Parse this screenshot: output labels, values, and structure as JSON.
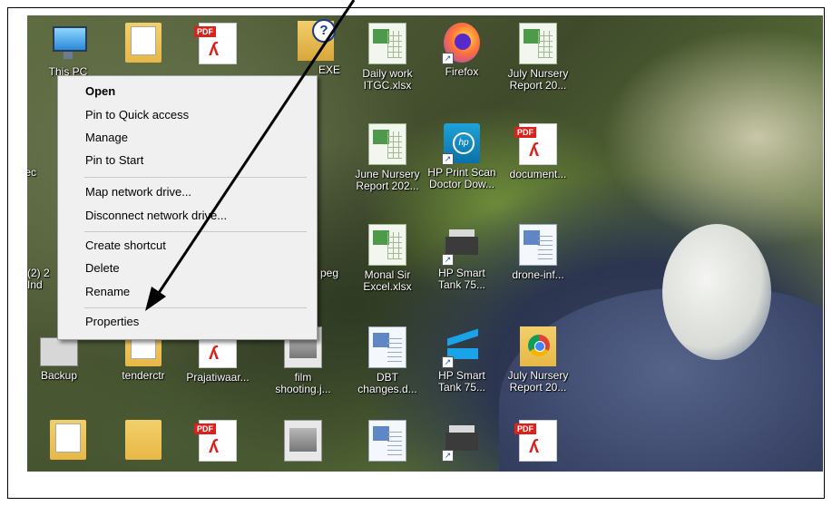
{
  "desktop": {
    "row1": [
      {
        "label": "This PC",
        "icon": "this-pc-icon"
      },
      {
        "label": "",
        "icon": "pdf-folder-icon"
      },
      {
        "label": "",
        "icon": "pdf-icon",
        "pdf_tag": "PDF"
      },
      {
        "label": "EXE",
        "icon": "help-folder-icon"
      },
      {
        "label": "Daily work\nITGC.xlsx",
        "icon": "excel-file-icon"
      },
      {
        "label": "Firefox",
        "icon": "firefox-icon"
      },
      {
        "label": "July Nursery\nReport 20...",
        "icon": "excel-file-icon"
      }
    ],
    "row2": [
      {
        "label": "Rec",
        "icon": "recycle-bin-icon"
      },
      {
        "label": "June Nursery\nReport 202...",
        "icon": "excel-file-icon"
      },
      {
        "label": "HP Print Scan\nDoctor Dow...",
        "icon": "hp-print-scan-doctor-icon"
      },
      {
        "label": "document...",
        "icon": "pdf-icon",
        "pdf_tag": "PDF"
      }
    ],
    "row3": [
      {
        "label": "(2) 2\nInd",
        "icon": "file-icon"
      },
      {
        "label": "peg",
        "icon": "image-file-icon"
      },
      {
        "label": "Monal Sir\nExcel.xlsx",
        "icon": "excel-file-icon"
      },
      {
        "label": "HP Smart\nTank 75...",
        "icon": "printer-icon"
      },
      {
        "label": "drone-inf...",
        "icon": "word-file-icon"
      }
    ],
    "row4": [
      {
        "label": "Backup",
        "icon": "drive-icon"
      },
      {
        "label": "tenderctr",
        "icon": "folder-icon"
      },
      {
        "label": "Prajatiwaar...",
        "icon": "pdf-icon"
      },
      {
        "label": "film\nshooting.j...",
        "icon": "image-file-icon"
      },
      {
        "label": "DBT\nchanges.d...",
        "icon": "word-file-icon"
      },
      {
        "label": "HP Smart\nTank 75...",
        "icon": "scanner-icon"
      },
      {
        "label": "July Nursery\nReport 20...",
        "icon": "chrome-folder-icon"
      }
    ],
    "row5": [
      {
        "label": "",
        "icon": "folder-icon"
      },
      {
        "label": "",
        "icon": "folder-icon"
      },
      {
        "label": "",
        "icon": "pdf-icon",
        "pdf_tag": "PDF"
      },
      {
        "label": "",
        "icon": "image-file-icon"
      },
      {
        "label": "",
        "icon": "word-file-icon"
      },
      {
        "label": "",
        "icon": "printer-icon"
      },
      {
        "label": "",
        "icon": "pdf-icon",
        "pdf_tag": "PDF"
      }
    ]
  },
  "context_menu": {
    "items": [
      {
        "label": "Open",
        "bold": true
      },
      {
        "label": "Pin to Quick access"
      },
      {
        "label": "Manage"
      },
      {
        "label": "Pin to Start"
      },
      {
        "label": "Map network drive..."
      },
      {
        "label": "Disconnect network drive..."
      },
      {
        "label": "Create shortcut"
      },
      {
        "label": "Delete"
      },
      {
        "label": "Rename"
      },
      {
        "label": "Properties"
      }
    ]
  },
  "annotation": {
    "arrow_color": "#000000",
    "points_to": "Properties"
  },
  "pdf_tag": "PDF",
  "help_symbol": "?",
  "hp_logo": "hp"
}
